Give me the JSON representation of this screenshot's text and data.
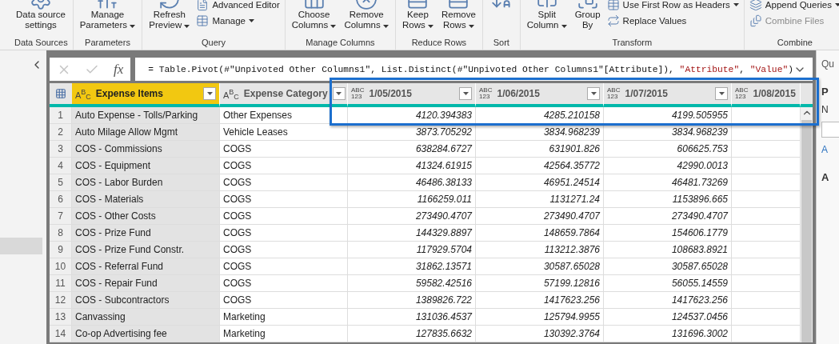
{
  "ribbon": {
    "groups": [
      {
        "label": "Data Sources",
        "items": [
          {
            "kind": "large",
            "lines": [
              "Data source",
              "settings"
            ],
            "dropdown": false
          }
        ]
      },
      {
        "label": "Parameters",
        "items": [
          {
            "kind": "large",
            "lines": [
              "Manage",
              "Parameters"
            ],
            "dropdown": true
          }
        ]
      },
      {
        "label": "Query",
        "items": [
          {
            "kind": "large",
            "lines": [
              "Refresh",
              "Preview"
            ],
            "dropdown": true
          },
          {
            "kind": "stack",
            "entries": [
              {
                "label": "Advanced Editor",
                "dropdown": false,
                "disabled": false
              },
              {
                "label": "Manage",
                "dropdown": true,
                "disabled": false
              }
            ]
          }
        ]
      },
      {
        "label": "Manage Columns",
        "items": [
          {
            "kind": "large",
            "lines": [
              "Choose",
              "Columns"
            ],
            "dropdown": true
          },
          {
            "kind": "large",
            "lines": [
              "Remove",
              "Columns"
            ],
            "dropdown": true
          }
        ]
      },
      {
        "label": "Reduce Rows",
        "items": [
          {
            "kind": "large",
            "lines": [
              "Keep",
              "Rows"
            ],
            "dropdown": true
          },
          {
            "kind": "large",
            "lines": [
              "Remove",
              "Rows"
            ],
            "dropdown": true
          }
        ]
      },
      {
        "label": "Sort",
        "items": [
          {
            "kind": "icon"
          }
        ]
      },
      {
        "label": "Transform",
        "items": [
          {
            "kind": "large",
            "lines": [
              "Split",
              "Column"
            ],
            "dropdown": true
          },
          {
            "kind": "large",
            "lines": [
              "Group",
              "By"
            ],
            "dropdown": false
          },
          {
            "kind": "stack",
            "entries": [
              {
                "label": "Use First Row as Headers",
                "dropdown": true,
                "disabled": false
              },
              {
                "label": "Replace Values",
                "dropdown": false,
                "disabled": false
              }
            ]
          }
        ]
      },
      {
        "label": "Combine",
        "items": [
          {
            "kind": "stack",
            "entries": [
              {
                "label": "Append Queries",
                "dropdown": true,
                "disabled": false
              },
              {
                "label": "Combine Files",
                "dropdown": false,
                "disabled": true
              }
            ]
          }
        ]
      }
    ]
  },
  "formula_bar": {
    "fx_label": "fx",
    "formula": [
      {
        "kind": "code",
        "text": "= Table.Pivot(#\"Unpivoted Other Columns1\", List.Distinct(#\"Unpivoted Other Columns1\"[Attribute]), "
      },
      {
        "kind": "string",
        "text": "\"Attribute\""
      },
      {
        "kind": "code",
        "text": ", "
      },
      {
        "kind": "string",
        "text": "\"Value\""
      },
      {
        "kind": "code",
        "text": ")"
      }
    ]
  },
  "table": {
    "columns": [
      {
        "name": "Expense Items",
        "type_badge": [
          "A",
          "B",
          "C"
        ],
        "kind": "text",
        "selected": true
      },
      {
        "name": "Expense Category",
        "type_badge": [
          "A",
          "B",
          "C"
        ],
        "kind": "text",
        "selected": false
      },
      {
        "name": "1/05/2015",
        "type_badge": [
          "ABC",
          "123"
        ],
        "kind": "any",
        "selected": false
      },
      {
        "name": "1/06/2015",
        "type_badge": [
          "ABC",
          "123"
        ],
        "kind": "any",
        "selected": false
      },
      {
        "name": "1/07/2015",
        "type_badge": [
          "ABC",
          "123"
        ],
        "kind": "any",
        "selected": false
      },
      {
        "name": "1/08/2015",
        "type_badge": [
          "ABC",
          "123"
        ],
        "kind": "any",
        "selected": false
      }
    ],
    "rows": [
      {
        "num": "1",
        "cells": [
          "Auto Expense - Tolls/Parking",
          "Other Expenses",
          "4120.394383",
          "4285.210158",
          "4199.505955"
        ]
      },
      {
        "num": "2",
        "cells": [
          "Auto Milage Allow Mgmt",
          "Vehicle Leases",
          "3873.705292",
          "3834.968239",
          "3834.968239"
        ]
      },
      {
        "num": "3",
        "cells": [
          "COS - Commissions",
          "COGS",
          "638284.6727",
          "631901.826",
          "606625.753"
        ]
      },
      {
        "num": "4",
        "cells": [
          "COS - Equipment",
          "COGS",
          "41324.61915",
          "42564.35772",
          "42990.0013"
        ]
      },
      {
        "num": "5",
        "cells": [
          "COS - Labor Burden",
          "COGS",
          "46486.38133",
          "46951.24514",
          "46481.73269"
        ]
      },
      {
        "num": "6",
        "cells": [
          "COS - Materials",
          "COGS",
          "1166259.011",
          "1131271.24",
          "1153896.665"
        ]
      },
      {
        "num": "7",
        "cells": [
          "COS - Other Costs",
          "COGS",
          "273490.4707",
          "273490.4707",
          "273490.4707"
        ]
      },
      {
        "num": "8",
        "cells": [
          "COS - Prize Fund",
          "COGS",
          "144329.8897",
          "148659.7864",
          "154606.1779"
        ]
      },
      {
        "num": "9",
        "cells": [
          "COS - Prize Fund Constr.",
          "COGS",
          "117929.5704",
          "113212.3876",
          "108683.8921"
        ]
      },
      {
        "num": "10",
        "cells": [
          "COS - Referral Fund",
          "COGS",
          "31862.13571",
          "30587.65028",
          "30587.65028"
        ]
      },
      {
        "num": "11",
        "cells": [
          "COS - Repair Fund",
          "COGS",
          "59582.42516",
          "57199.12816",
          "56055.14559"
        ]
      },
      {
        "num": "12",
        "cells": [
          "COS - Subcontractors",
          "COGS",
          "1389826.722",
          "1417623.256",
          "1417623.256"
        ]
      },
      {
        "num": "13",
        "cells": [
          "Canvassing",
          "Marketing",
          "131036.4537",
          "125794.9955",
          "124537.0456"
        ]
      },
      {
        "num": "14",
        "cells": [
          "Co-op Advertising fee",
          "Marketing",
          "127835.6632",
          "130392.3764",
          "131696.3002"
        ]
      }
    ]
  },
  "right_panel": {
    "title": "Qu",
    "section_1": "P",
    "label": "N",
    "link": "A",
    "section_2": "A"
  }
}
